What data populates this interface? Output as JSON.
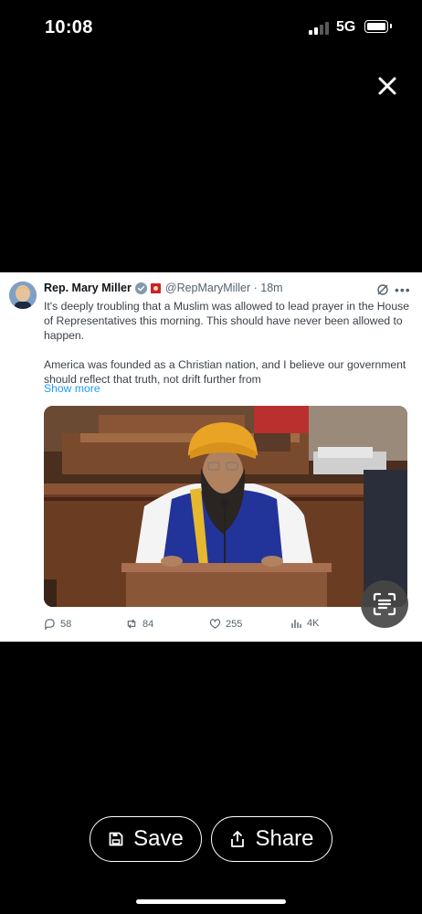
{
  "status_bar": {
    "time": "10:08",
    "network": "5G"
  },
  "tweet": {
    "author": "Rep. Mary Miller",
    "handle": "@RepMaryMiller · 18m",
    "text_p1": "It's deeply troubling that a Muslim was allowed to lead prayer in the House of Representatives this morning. This should have never been allowed to happen.",
    "text_p2": "America was founded as a Christian nation, and I believe our government should reflect that truth, not drift further from",
    "show_more": "Show more",
    "replies": "58",
    "reposts": "84",
    "likes": "255",
    "views": "4K"
  },
  "buttons": {
    "save": "Save",
    "share": "Share"
  },
  "icons": {
    "close": "close-icon",
    "verified": "verified-badge-icon",
    "grok": "grok-icon",
    "more": "more-options-icon",
    "reply": "reply-icon",
    "repost": "repost-icon",
    "like": "heart-icon",
    "views": "views-icon",
    "lens": "text-scan-icon",
    "save": "save-icon",
    "share": "share-icon"
  },
  "colors": {
    "link": "#1d9bf0",
    "verified": "#829aab",
    "background": "#000000"
  }
}
